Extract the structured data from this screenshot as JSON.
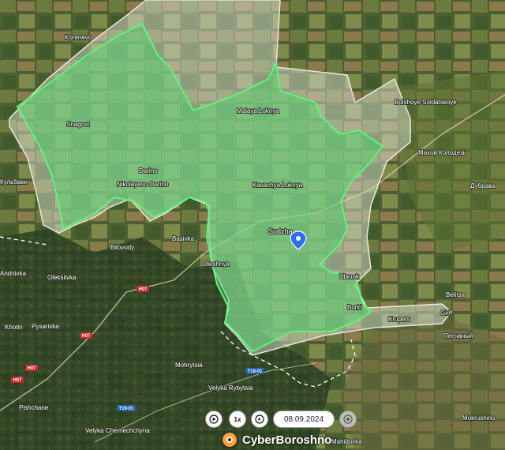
{
  "map": {
    "places": [
      {
        "name": "Korenevo"
      },
      {
        "name": "Snagost"
      },
      {
        "name": "Malaya Loknya"
      },
      {
        "name": "Bolshoye Soldatskoye"
      },
      {
        "name": "Махов Колодезь"
      },
      {
        "name": "Кульбаки"
      },
      {
        "name": "Darino"
      },
      {
        "name": "Nikolayevo-Darino"
      },
      {
        "name": "Kasachya Loknya"
      },
      {
        "name": "Дубрава"
      },
      {
        "name": "Basivka"
      },
      {
        "name": "Bilovody"
      },
      {
        "name": "Sudzha"
      },
      {
        "name": "Andriivka"
      },
      {
        "name": "Oleksiivka"
      },
      {
        "name": "Oleshnya"
      },
      {
        "name": "Ulanok"
      },
      {
        "name": "Belitsa"
      },
      {
        "name": "Borki"
      },
      {
        "name": "Krupets"
      },
      {
        "name": "Giri"
      },
      {
        "name": "Khotin"
      },
      {
        "name": "Pysarivka"
      },
      {
        "name": "Песчаный"
      },
      {
        "name": "Mohrytsia"
      },
      {
        "name": "Velyka Rybytsia"
      },
      {
        "name": "Pishchane"
      },
      {
        "name": "Velyka Chernechchyna"
      },
      {
        "name": "Mokrushino"
      },
      {
        "name": "Mahidovka"
      }
    ],
    "roads": [
      {
        "label": "H07"
      },
      {
        "label": "H07"
      },
      {
        "label": "H07"
      },
      {
        "label": "H07"
      },
      {
        "label": "T19-01"
      },
      {
        "label": "T19-01"
      }
    ],
    "colors": {
      "controlled_fill": "#4fd16a",
      "controlled_stroke": "#5cf57e",
      "contested_fill": "#d8dccd",
      "marker": "#2f6cf0"
    },
    "marker": {
      "name": "location-pin-icon",
      "place": "Sudzha"
    }
  },
  "controls": {
    "play_icon": "play-icon",
    "speed": "1x",
    "step_icon": "step-icon",
    "date": "08.09.2024",
    "next_icon": "next-icon"
  },
  "brand": {
    "name": "CyberBoroshno"
  }
}
